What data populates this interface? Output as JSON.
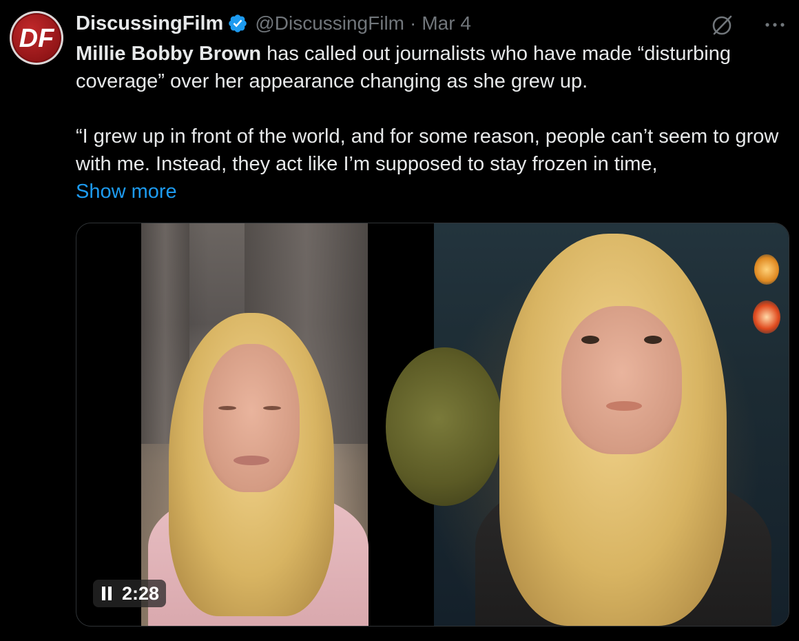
{
  "tweet": {
    "display_name": "DiscussingFilm",
    "handle": "@DiscussingFilm",
    "separator": "·",
    "date": "Mar 4",
    "avatar_text": "DF",
    "verified": true,
    "text_bold": "Millie Bobby Brown",
    "text_line1_rest": " has called out journalists who have made “disturbing coverage” over her appearance changing as she grew up.",
    "quote_text": "“I grew up in front of the world, and for some reason, people can’t seem to grow with me. Instead, they act like I’m supposed to stay frozen in time,",
    "show_more": "Show more"
  },
  "video": {
    "duration": "2:28",
    "state": "playing"
  },
  "icons": {
    "verified": "verified-badge-icon",
    "grok": "grok-icon",
    "more": "more-options-icon",
    "pause": "pause-icon"
  },
  "colors": {
    "background": "#000000",
    "text": "#e7e9ea",
    "muted": "#71767b",
    "link": "#1d9bf0",
    "verified": "#1d9bf0"
  }
}
